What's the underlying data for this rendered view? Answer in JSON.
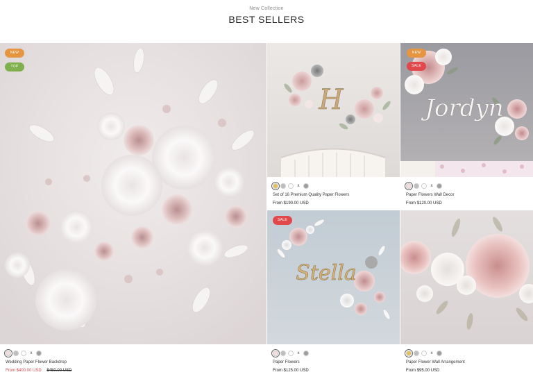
{
  "header": {
    "eyebrow": "New Collection",
    "title": "BEST SELLERS"
  },
  "colors": {
    "badge_new": "#e69540",
    "badge_top": "#7fb04c",
    "badge_sale": "#e0484b",
    "sale_price": "#e0484b"
  },
  "products": [
    {
      "badges": [
        "NEW",
        "TOP"
      ],
      "swatches": [
        "#f3dede",
        "#bdbdbd",
        "#ffffff",
        "x",
        "#9e9e9e"
      ],
      "name": "Wedding Paper Flower Backdrop",
      "price_prefix": "From",
      "price": "$400.00 USD",
      "compare_price": "$450.00 USD"
    },
    {
      "badges": [],
      "swatches": [
        "#e7c05a",
        "#bdbdbd",
        "#ffffff",
        "x",
        "#9e9e9e"
      ],
      "name": "Set of 16 Premium Quality Paper Flowers",
      "price_prefix": "From",
      "price": "$190.00 USD"
    },
    {
      "badges": [
        "NEW",
        "SALE"
      ],
      "swatches": [
        "#f3dede",
        "#bdbdbd",
        "#ffffff",
        "x",
        "#9e9e9e"
      ],
      "name": "Paper Flowers Wall Decor",
      "price_prefix": "From",
      "price": "$120.00 USD"
    },
    {
      "badges": [
        "SALE"
      ],
      "swatches": [
        "#f3dede",
        "#bdbdbd",
        "#ffffff",
        "x",
        "#9e9e9e"
      ],
      "name": "Paper Flowers",
      "price_prefix": "From",
      "price": "$125.00 USD"
    },
    {
      "badges": [],
      "swatches": [
        "#e7c05a",
        "#bdbdbd",
        "#ffffff",
        "x",
        "#9e9e9e"
      ],
      "name": "Paper Flower Wall Arrangement",
      "price_prefix": "From",
      "price": "$95.00 USD"
    }
  ],
  "photo_text": {
    "monogram": "H",
    "name_sign_1": "Jordyn",
    "name_sign_2": "Stella"
  }
}
